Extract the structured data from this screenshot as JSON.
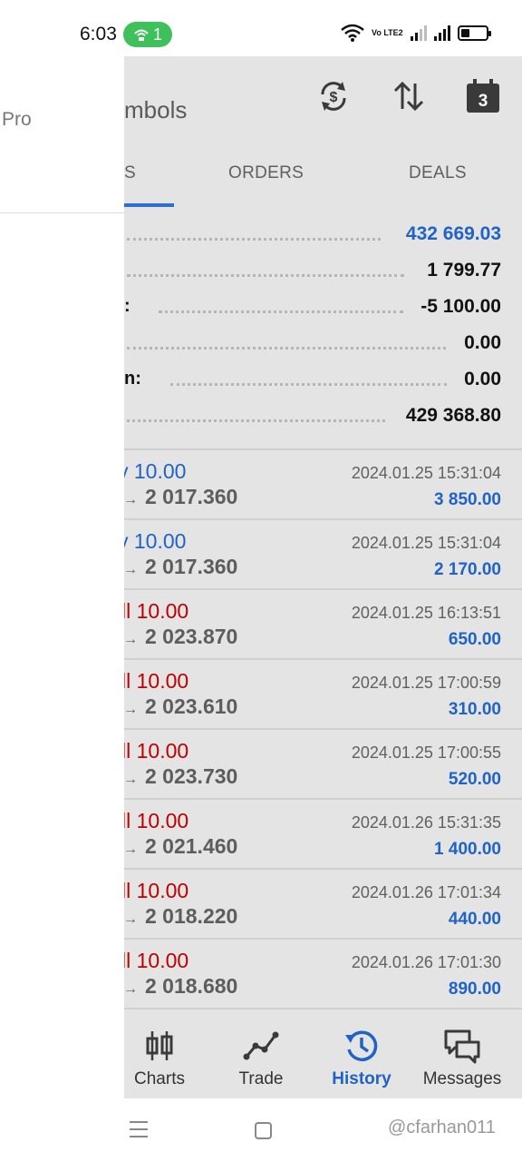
{
  "status_bar": {
    "time": "6:03",
    "hotspot_count": "1",
    "network_label": "Vo LTE2"
  },
  "drawer": {
    "partial_text": "Pro"
  },
  "toolbar": {
    "title_partial": "mbols"
  },
  "tabs": [
    {
      "label": "S",
      "active": true
    },
    {
      "label": "ORDERS",
      "active": false
    },
    {
      "label": "DEALS",
      "active": false
    }
  ],
  "summary": {
    "rows": [
      {
        "label": "",
        "value": "432 669.03",
        "highlight": true
      },
      {
        "label": "",
        "value": "1 799.77",
        "highlight": false
      },
      {
        "label": ":",
        "value": "-5 100.00",
        "highlight": false
      },
      {
        "label": "",
        "value": "0.00",
        "highlight": false
      },
      {
        "label": "n:",
        "value": "0.00",
        "highlight": false
      },
      {
        "label": "",
        "value": "429 368.80",
        "highlight": false
      }
    ]
  },
  "deals": [
    {
      "side": "buy",
      "type_text": "y 10.00",
      "arrow": "→",
      "price": "2 017.360",
      "datetime": "2024.01.25 15:31:04",
      "profit": "3 850.00"
    },
    {
      "side": "buy",
      "type_text": "y 10.00",
      "arrow": "→",
      "price": "2 017.360",
      "datetime": "2024.01.25 15:31:04",
      "profit": "2 170.00"
    },
    {
      "side": "sell",
      "type_text": "ll 10.00",
      "arrow": "→",
      "price": "2 023.870",
      "datetime": "2024.01.25 16:13:51",
      "profit": "650.00"
    },
    {
      "side": "sell",
      "type_text": "ll 10.00",
      "arrow": "→",
      "price": "2 023.610",
      "datetime": "2024.01.25 17:00:59",
      "profit": "310.00"
    },
    {
      "side": "sell",
      "type_text": "ll 10.00",
      "arrow": "→",
      "price": "2 023.730",
      "datetime": "2024.01.25 17:00:55",
      "profit": "520.00"
    },
    {
      "side": "sell",
      "type_text": "ll 10.00",
      "arrow": "→",
      "price": "2 021.460",
      "datetime": "2024.01.26 15:31:35",
      "profit": "1 400.00"
    },
    {
      "side": "sell",
      "type_text": "ll 10.00",
      "arrow": "→",
      "price": "2 018.220",
      "datetime": "2024.01.26 17:01:34",
      "profit": "440.00"
    },
    {
      "side": "sell",
      "type_text": "ll 10.00",
      "arrow": "→",
      "price": "2 018.680",
      "datetime": "2024.01.26 17:01:30",
      "profit": "890.00"
    }
  ],
  "bottom_nav": [
    {
      "label": "Charts",
      "icon": "candlestick-icon",
      "active": false
    },
    {
      "label": "Trade",
      "icon": "trend-line-icon",
      "active": false
    },
    {
      "label": "History",
      "icon": "history-icon",
      "active": true
    },
    {
      "label": "Messages",
      "icon": "messages-icon",
      "active": false
    }
  ],
  "calendar_badge": "3",
  "watermark": "@cfarhan011",
  "colors": {
    "accent_blue": "#1f63c6",
    "sell_red": "#c00000",
    "scrim_gray": "#e4e4e4",
    "hotspot_green": "#3ec05a"
  }
}
